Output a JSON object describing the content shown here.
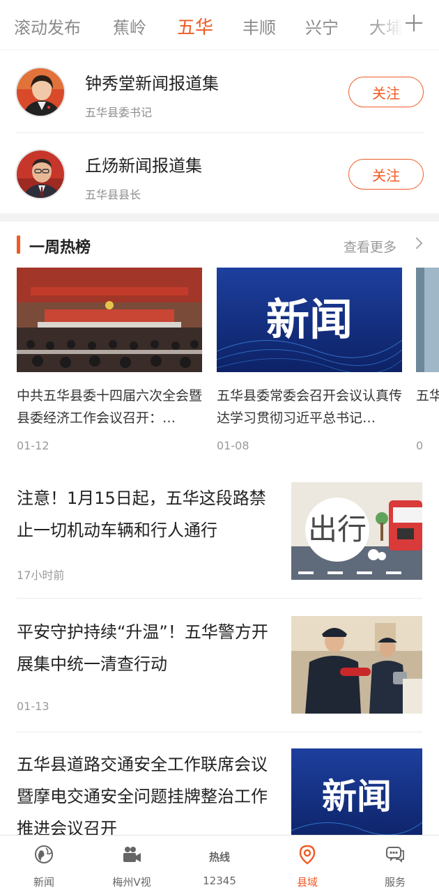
{
  "tabs": {
    "items": [
      "滚动发布",
      "蕉岭",
      "五华",
      "丰顺",
      "兴宁",
      "大埔"
    ],
    "active_index": 2,
    "add_icon": "plus-icon"
  },
  "follow": {
    "items": [
      {
        "name": "钟秀堂新闻报道集",
        "role": "五华县委书记",
        "button": "关注"
      },
      {
        "name": "丘炀新闻报道集",
        "role": "五华县县长",
        "button": "关注"
      }
    ]
  },
  "hot": {
    "title": "一周热榜",
    "more": "查看更多",
    "cards": [
      {
        "title": "中共五华县委十四届六次全会暨县委经济工作会议召开：…",
        "date": "01-12"
      },
      {
        "title": "五华县委常委会召开会议认真传达学习贯彻习近平总书记…",
        "date": "01-08",
        "image_text": "新闻"
      },
      {
        "title": "五华",
        "date": "0"
      }
    ]
  },
  "news": {
    "items": [
      {
        "title": "注意！1月15日起，五华这段路禁止一切机动车辆和行人通行",
        "meta": "17小时前",
        "image_text": "出行"
      },
      {
        "title": "平安守护持续“升温”！五华警方开展集中统一清查行动",
        "meta": "01-13"
      },
      {
        "title": "五华县道路交通安全工作联席会议暨摩电交通安全问题挂牌整治工作推进会议召开",
        "meta": "",
        "image_text": "新闻"
      }
    ]
  },
  "bottom_nav": {
    "items": [
      {
        "label": "新闻",
        "icon": "globe-icon"
      },
      {
        "label": "梅州V视",
        "icon": "video-camera-icon"
      },
      {
        "label": "12345",
        "icon": "hotline-icon",
        "icon_text": "热线"
      },
      {
        "label": "县域",
        "icon": "location-pin-icon"
      },
      {
        "label": "服务",
        "icon": "chat-bubble-icon"
      }
    ],
    "active_index": 3
  },
  "colors": {
    "accent": "#f05a24",
    "text": "#222222",
    "muted": "#9a9a9a"
  }
}
